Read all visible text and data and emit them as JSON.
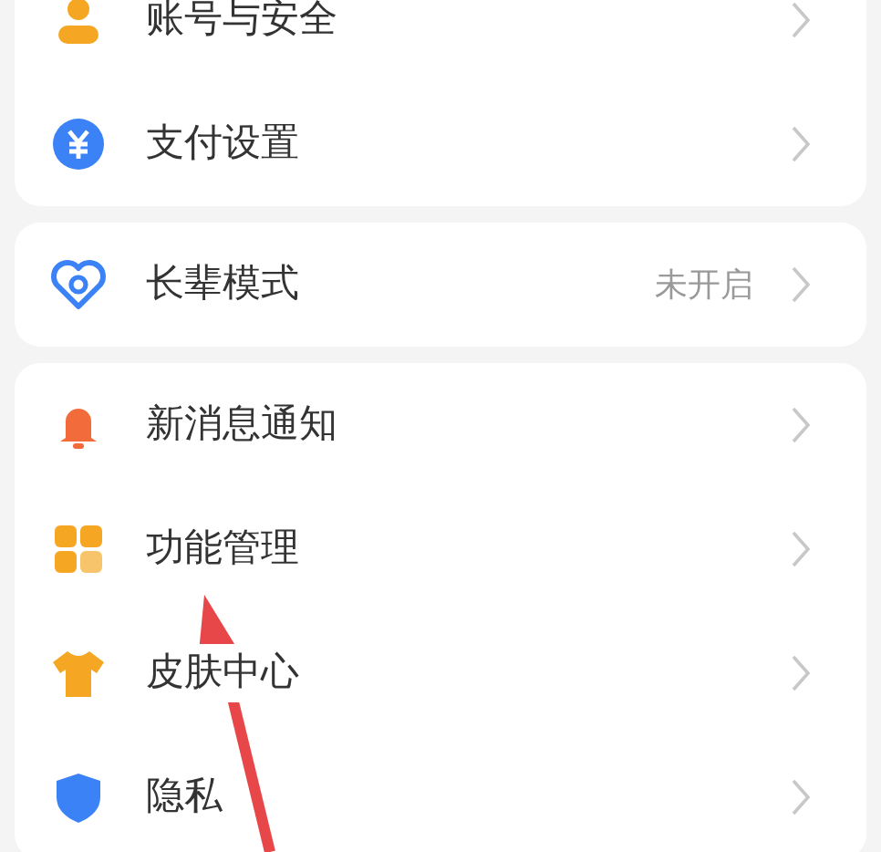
{
  "groups": [
    {
      "items": [
        {
          "label": "账号与安全"
        },
        {
          "label": "支付设置"
        }
      ]
    },
    {
      "items": [
        {
          "label": "长辈模式",
          "value": "未开启"
        }
      ]
    },
    {
      "items": [
        {
          "label": "新消息通知"
        },
        {
          "label": "功能管理"
        },
        {
          "label": "皮肤中心"
        },
        {
          "label": "隐私"
        }
      ]
    }
  ]
}
